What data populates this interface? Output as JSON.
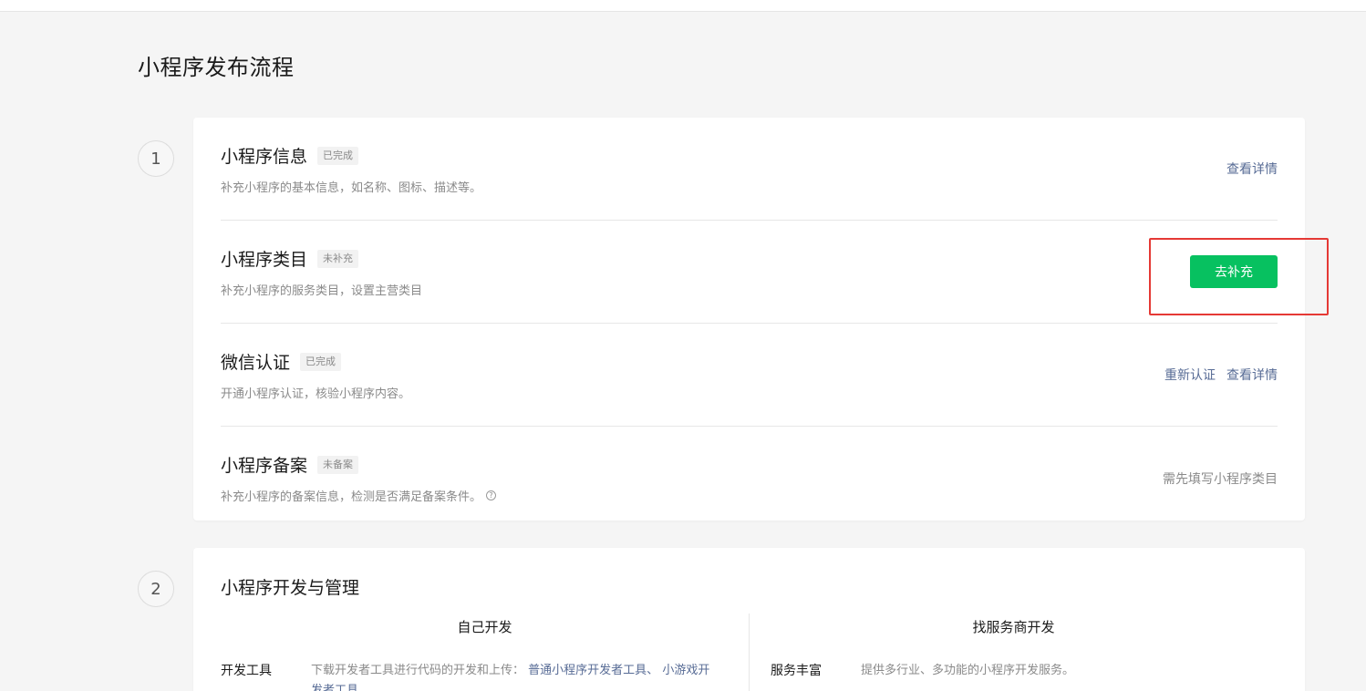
{
  "page": {
    "title": "小程序发布流程"
  },
  "steps": [
    {
      "number": "1"
    },
    {
      "number": "2"
    }
  ],
  "section1": {
    "rows": [
      {
        "title": "小程序信息",
        "badge": "已完成",
        "desc": "补充小程序的基本信息，如名称、图标、描述等。",
        "actions": [
          "查看详情"
        ]
      },
      {
        "title": "小程序类目",
        "badge": "未补充",
        "desc": "补充小程序的服务类目，设置主营类目",
        "button": "去补充"
      },
      {
        "title": "微信认证",
        "badge": "已完成",
        "desc": "开通小程序认证，核验小程序内容。",
        "actions": [
          "重新认证",
          "查看详情"
        ]
      },
      {
        "title": "小程序备案",
        "badge": "未备案",
        "desc": "补充小程序的备案信息，检测是否满足备案条件。",
        "help_icon": "?",
        "hint": "需先填写小程序类目"
      }
    ]
  },
  "section2": {
    "title": "小程序开发与管理",
    "left": {
      "heading": "自己开发",
      "label": "开发工具",
      "desc_prefix": "下载开发者工具进行代码的开发和上传：",
      "link1": "普通小程序开发者工具",
      "sep": "、",
      "link2": "小游戏开发者工具"
    },
    "right": {
      "heading": "找服务商开发",
      "label": "服务丰富",
      "desc": "提供多行业、多功能的小程序开发服务。"
    }
  },
  "colors": {
    "accent_green": "#07c160",
    "link_blue": "#576b95",
    "highlight_red": "#e53935"
  }
}
